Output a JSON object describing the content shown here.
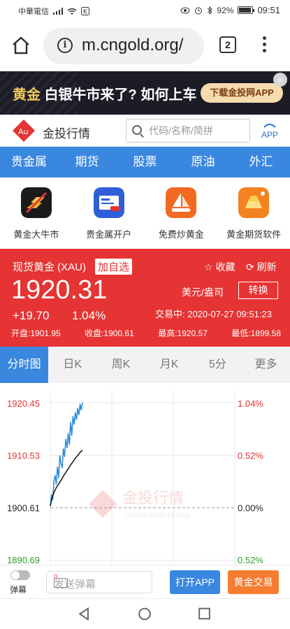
{
  "status_bar": {
    "carrier": "中華電信",
    "battery": "92%",
    "time": "09:51"
  },
  "browser": {
    "url": "m.cngold.org/",
    "tab_count": "2"
  },
  "ad": {
    "text_highlight": "黄金",
    "text_main": " 白银牛市来了? 如何上车",
    "cta": "下载金投网APP",
    "close": "×"
  },
  "header": {
    "logo_text": "Au",
    "brand": "金投行情",
    "search_placeholder": "代码/名称/简拼",
    "app_label": "APP"
  },
  "nav": [
    "贵金属",
    "期货",
    "股票",
    "原油",
    "外汇"
  ],
  "shortcuts": [
    {
      "label": "黄金大牛市",
      "color": "#1b1b1b"
    },
    {
      "label": "贵金属开户",
      "color": "#2f5fd8"
    },
    {
      "label": "免费炒黄金",
      "color": "#f26a21"
    },
    {
      "label": "黄金期货软件",
      "color": "#f58220"
    }
  ],
  "quote": {
    "name": "现货黄金 (XAU)",
    "add_watch": "加自选",
    "favorite": "收藏",
    "refresh": "刷新",
    "price": "1920.31",
    "change": "+19.70",
    "change_pct": "1.04%",
    "unit": "美元/盎司",
    "convert": "转换",
    "trade_time": "交易中:  2020-07-27 09:51:23",
    "open": "开盘:1901.95",
    "close": "收盘:1900.61",
    "high": "最高:1920.57",
    "low": "最低:1899.58"
  },
  "chart_tabs": [
    "分时图",
    "日K",
    "周K",
    "月K",
    "5分",
    "更多"
  ],
  "chart_data": {
    "type": "line",
    "y_left_labels": [
      "1920.45",
      "1910.53",
      "1900.61",
      "1890.69"
    ],
    "y_right_labels": [
      "1.04%",
      "0.52%",
      "0.00%",
      "0.52%"
    ],
    "ylim": [
      1890.69,
      1920.45
    ],
    "baseline": 1900.61,
    "watermark": "金投行情",
    "watermark_url": "quote.cngold.org",
    "series": [
      {
        "color": "#2a8ad8",
        "values": [
          1900.9,
          1903.2,
          1902.1,
          1905.5,
          1906.8,
          1905.0,
          1908.4,
          1906.2,
          1910.5,
          1909.0,
          1908.1,
          1911.8,
          1910.2,
          1913.6,
          1911.9,
          1914.7,
          1912.5,
          1916.8,
          1914.2,
          1917.9,
          1916.3,
          1918.6,
          1917.2,
          1919.4,
          1918.1,
          1920.2,
          1919.0,
          1920.45
        ]
      },
      {
        "color": "#111111",
        "values": [
          1901.0,
          1902.3,
          1903.2,
          1903.9,
          1904.5,
          1904.9,
          1905.4,
          1905.8,
          1906.3,
          1906.8,
          1907.2,
          1907.7,
          1908.1,
          1908.6,
          1909.0,
          1909.4,
          1909.8,
          1910.2,
          1910.5,
          1910.9,
          1911.2,
          1911.5
        ]
      }
    ]
  },
  "bottom_bar": {
    "danmu_label": "弹幕",
    "danmu_placeholder": "发送弹幕",
    "danmu_count": "0",
    "open_app": "打开APP",
    "gold_trade": "黄金交易"
  }
}
